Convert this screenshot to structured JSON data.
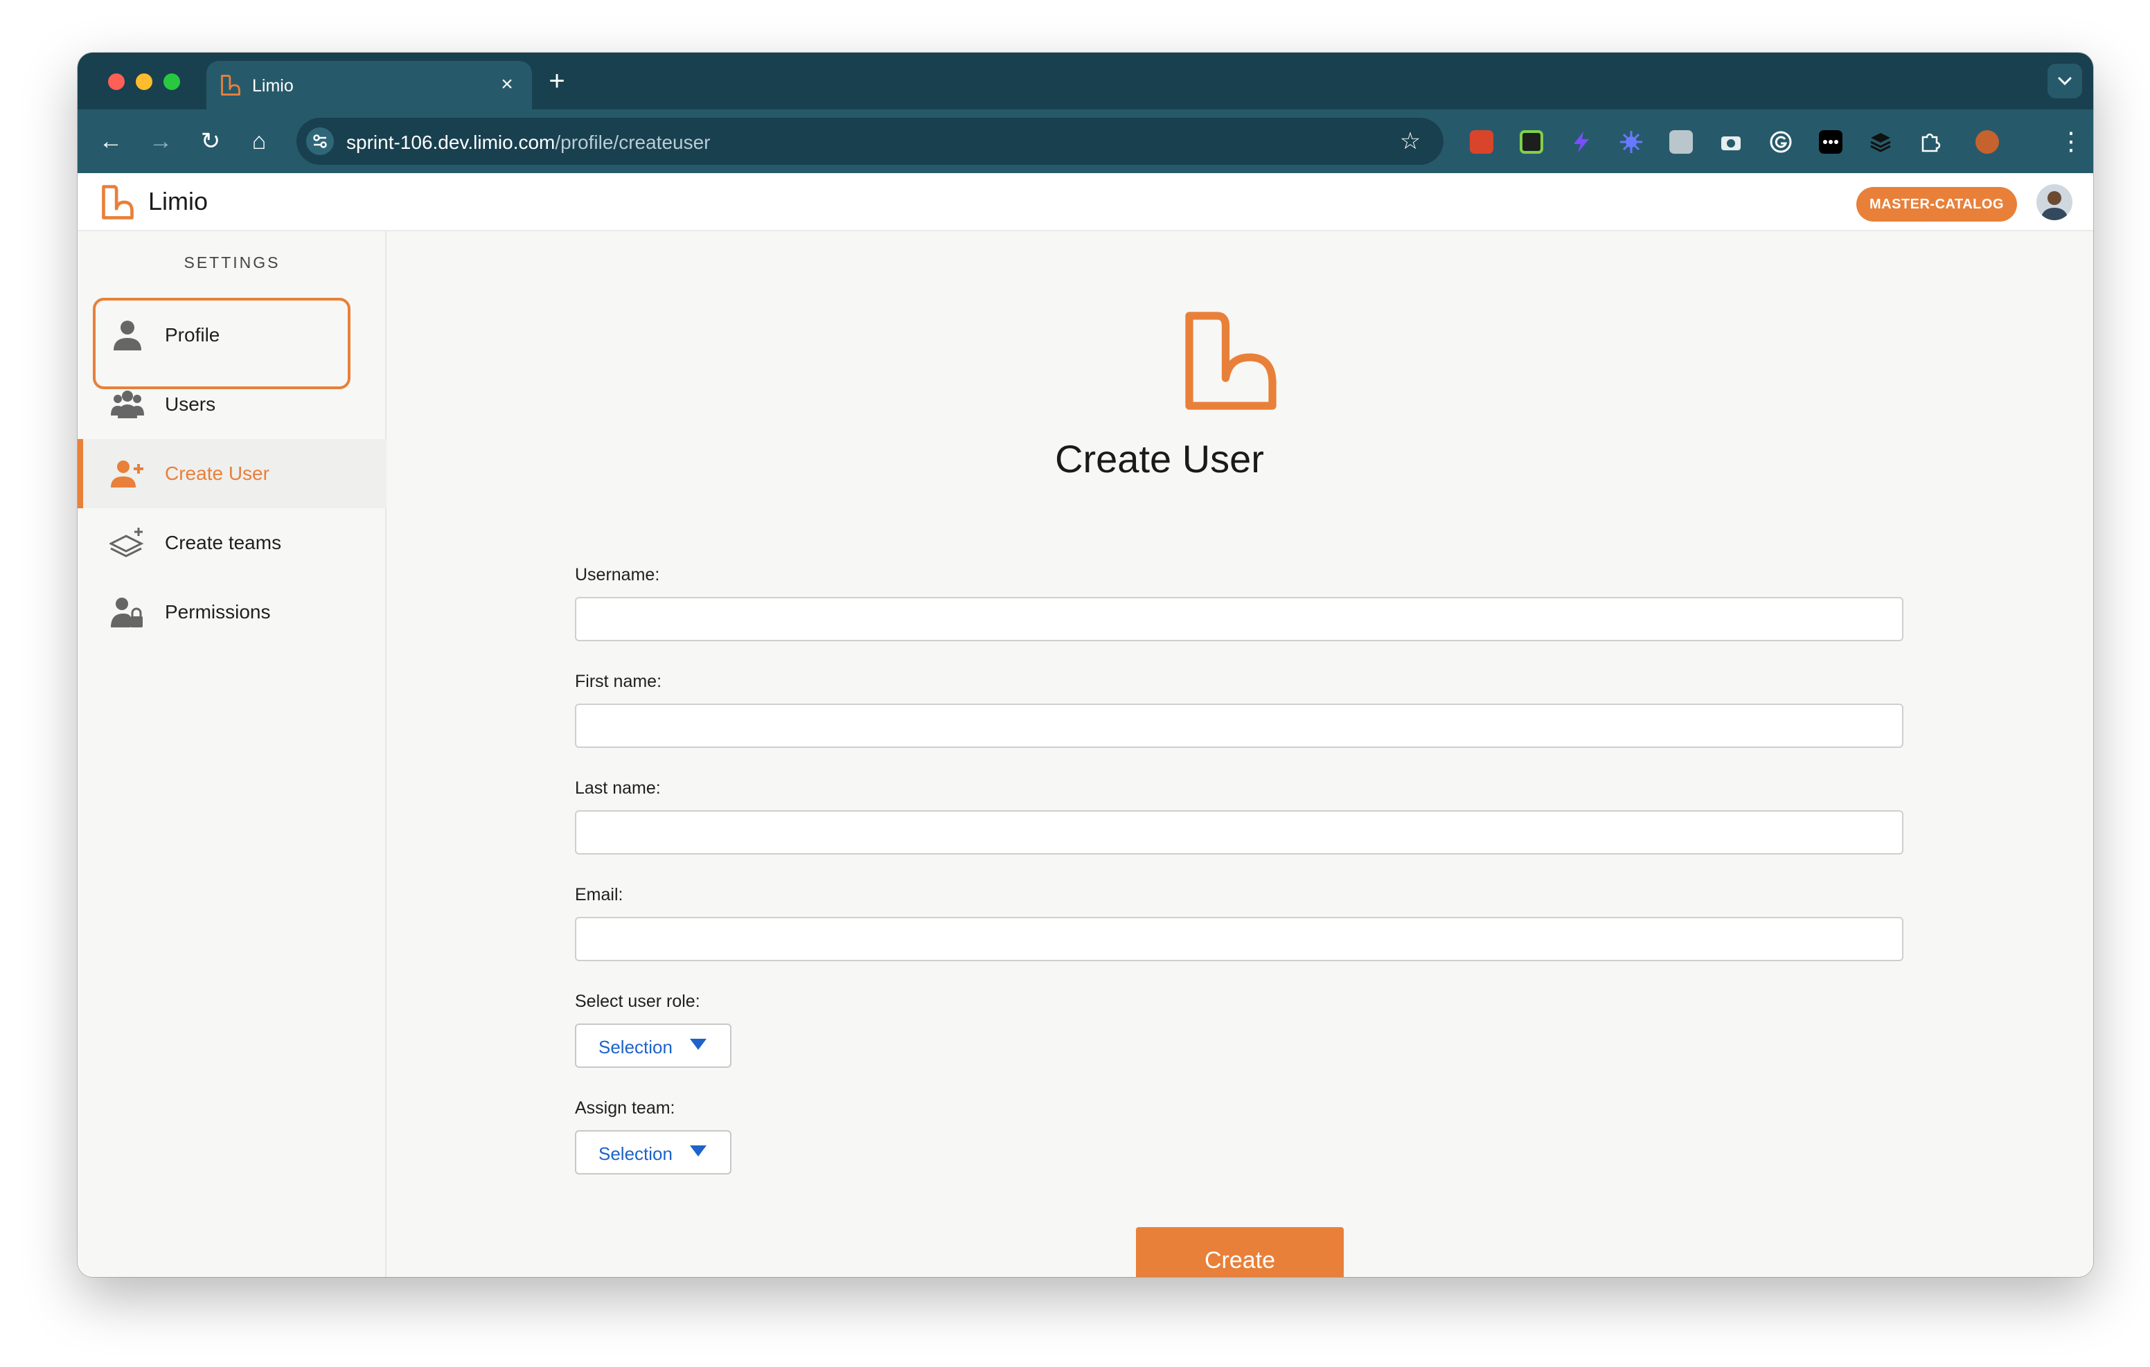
{
  "browser": {
    "tab_title": "Limio",
    "tab_close": "×",
    "new_tab": "+",
    "url_host": "sprint-106.dev.limio.com",
    "url_path": "/profile/createuser",
    "back_glyph": "←",
    "forward_glyph": "→",
    "reload_glyph": "↻",
    "home_glyph": "⌂",
    "star_glyph": "☆",
    "menu_glyph": "⋮"
  },
  "app": {
    "brand": "Limio",
    "catalog_badge": "MASTER-CATALOG",
    "accent_color": "#e8803a"
  },
  "sidebar": {
    "heading": "SETTINGS",
    "items": [
      {
        "label": "Profile",
        "icon": "person-icon",
        "active": false
      },
      {
        "label": "Users",
        "icon": "users-group-icon",
        "active": false
      },
      {
        "label": "Create User",
        "icon": "person-add-icon",
        "active": true
      },
      {
        "label": "Create teams",
        "icon": "layers-add-icon",
        "active": false
      },
      {
        "label": "Permissions",
        "icon": "person-lock-icon",
        "active": false
      }
    ]
  },
  "form": {
    "title": "Create User",
    "username_label": "Username:",
    "username_value": "",
    "first_name_label": "First name:",
    "first_name_value": "",
    "last_name_label": "Last name:",
    "last_name_value": "",
    "email_label": "Email:",
    "email_value": "",
    "role_label": "Select user role:",
    "role_value": "Selection",
    "team_label": "Assign team:",
    "team_value": "Selection",
    "submit_label": "Create"
  }
}
